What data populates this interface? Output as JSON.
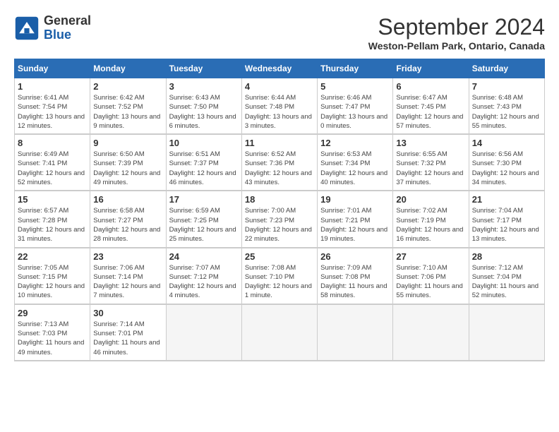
{
  "header": {
    "logo_general": "General",
    "logo_blue": "Blue",
    "month_title": "September 2024",
    "location": "Weston-Pellam Park, Ontario, Canada"
  },
  "weekdays": [
    "Sunday",
    "Monday",
    "Tuesday",
    "Wednesday",
    "Thursday",
    "Friday",
    "Saturday"
  ],
  "weeks": [
    [
      {
        "day": "1",
        "sunrise": "Sunrise: 6:41 AM",
        "sunset": "Sunset: 7:54 PM",
        "daylight": "Daylight: 13 hours and 12 minutes."
      },
      {
        "day": "2",
        "sunrise": "Sunrise: 6:42 AM",
        "sunset": "Sunset: 7:52 PM",
        "daylight": "Daylight: 13 hours and 9 minutes."
      },
      {
        "day": "3",
        "sunrise": "Sunrise: 6:43 AM",
        "sunset": "Sunset: 7:50 PM",
        "daylight": "Daylight: 13 hours and 6 minutes."
      },
      {
        "day": "4",
        "sunrise": "Sunrise: 6:44 AM",
        "sunset": "Sunset: 7:48 PM",
        "daylight": "Daylight: 13 hours and 3 minutes."
      },
      {
        "day": "5",
        "sunrise": "Sunrise: 6:46 AM",
        "sunset": "Sunset: 7:47 PM",
        "daylight": "Daylight: 13 hours and 0 minutes."
      },
      {
        "day": "6",
        "sunrise": "Sunrise: 6:47 AM",
        "sunset": "Sunset: 7:45 PM",
        "daylight": "Daylight: 12 hours and 57 minutes."
      },
      {
        "day": "7",
        "sunrise": "Sunrise: 6:48 AM",
        "sunset": "Sunset: 7:43 PM",
        "daylight": "Daylight: 12 hours and 55 minutes."
      }
    ],
    [
      {
        "day": "8",
        "sunrise": "Sunrise: 6:49 AM",
        "sunset": "Sunset: 7:41 PM",
        "daylight": "Daylight: 12 hours and 52 minutes."
      },
      {
        "day": "9",
        "sunrise": "Sunrise: 6:50 AM",
        "sunset": "Sunset: 7:39 PM",
        "daylight": "Daylight: 12 hours and 49 minutes."
      },
      {
        "day": "10",
        "sunrise": "Sunrise: 6:51 AM",
        "sunset": "Sunset: 7:37 PM",
        "daylight": "Daylight: 12 hours and 46 minutes."
      },
      {
        "day": "11",
        "sunrise": "Sunrise: 6:52 AM",
        "sunset": "Sunset: 7:36 PM",
        "daylight": "Daylight: 12 hours and 43 minutes."
      },
      {
        "day": "12",
        "sunrise": "Sunrise: 6:53 AM",
        "sunset": "Sunset: 7:34 PM",
        "daylight": "Daylight: 12 hours and 40 minutes."
      },
      {
        "day": "13",
        "sunrise": "Sunrise: 6:55 AM",
        "sunset": "Sunset: 7:32 PM",
        "daylight": "Daylight: 12 hours and 37 minutes."
      },
      {
        "day": "14",
        "sunrise": "Sunrise: 6:56 AM",
        "sunset": "Sunset: 7:30 PM",
        "daylight": "Daylight: 12 hours and 34 minutes."
      }
    ],
    [
      {
        "day": "15",
        "sunrise": "Sunrise: 6:57 AM",
        "sunset": "Sunset: 7:28 PM",
        "daylight": "Daylight: 12 hours and 31 minutes."
      },
      {
        "day": "16",
        "sunrise": "Sunrise: 6:58 AM",
        "sunset": "Sunset: 7:27 PM",
        "daylight": "Daylight: 12 hours and 28 minutes."
      },
      {
        "day": "17",
        "sunrise": "Sunrise: 6:59 AM",
        "sunset": "Sunset: 7:25 PM",
        "daylight": "Daylight: 12 hours and 25 minutes."
      },
      {
        "day": "18",
        "sunrise": "Sunrise: 7:00 AM",
        "sunset": "Sunset: 7:23 PM",
        "daylight": "Daylight: 12 hours and 22 minutes."
      },
      {
        "day": "19",
        "sunrise": "Sunrise: 7:01 AM",
        "sunset": "Sunset: 7:21 PM",
        "daylight": "Daylight: 12 hours and 19 minutes."
      },
      {
        "day": "20",
        "sunrise": "Sunrise: 7:02 AM",
        "sunset": "Sunset: 7:19 PM",
        "daylight": "Daylight: 12 hours and 16 minutes."
      },
      {
        "day": "21",
        "sunrise": "Sunrise: 7:04 AM",
        "sunset": "Sunset: 7:17 PM",
        "daylight": "Daylight: 12 hours and 13 minutes."
      }
    ],
    [
      {
        "day": "22",
        "sunrise": "Sunrise: 7:05 AM",
        "sunset": "Sunset: 7:15 PM",
        "daylight": "Daylight: 12 hours and 10 minutes."
      },
      {
        "day": "23",
        "sunrise": "Sunrise: 7:06 AM",
        "sunset": "Sunset: 7:14 PM",
        "daylight": "Daylight: 12 hours and 7 minutes."
      },
      {
        "day": "24",
        "sunrise": "Sunrise: 7:07 AM",
        "sunset": "Sunset: 7:12 PM",
        "daylight": "Daylight: 12 hours and 4 minutes."
      },
      {
        "day": "25",
        "sunrise": "Sunrise: 7:08 AM",
        "sunset": "Sunset: 7:10 PM",
        "daylight": "Daylight: 12 hours and 1 minute."
      },
      {
        "day": "26",
        "sunrise": "Sunrise: 7:09 AM",
        "sunset": "Sunset: 7:08 PM",
        "daylight": "Daylight: 11 hours and 58 minutes."
      },
      {
        "day": "27",
        "sunrise": "Sunrise: 7:10 AM",
        "sunset": "Sunset: 7:06 PM",
        "daylight": "Daylight: 11 hours and 55 minutes."
      },
      {
        "day": "28",
        "sunrise": "Sunrise: 7:12 AM",
        "sunset": "Sunset: 7:04 PM",
        "daylight": "Daylight: 11 hours and 52 minutes."
      }
    ],
    [
      {
        "day": "29",
        "sunrise": "Sunrise: 7:13 AM",
        "sunset": "Sunset: 7:03 PM",
        "daylight": "Daylight: 11 hours and 49 minutes."
      },
      {
        "day": "30",
        "sunrise": "Sunrise: 7:14 AM",
        "sunset": "Sunset: 7:01 PM",
        "daylight": "Daylight: 11 hours and 46 minutes."
      },
      null,
      null,
      null,
      null,
      null
    ]
  ]
}
